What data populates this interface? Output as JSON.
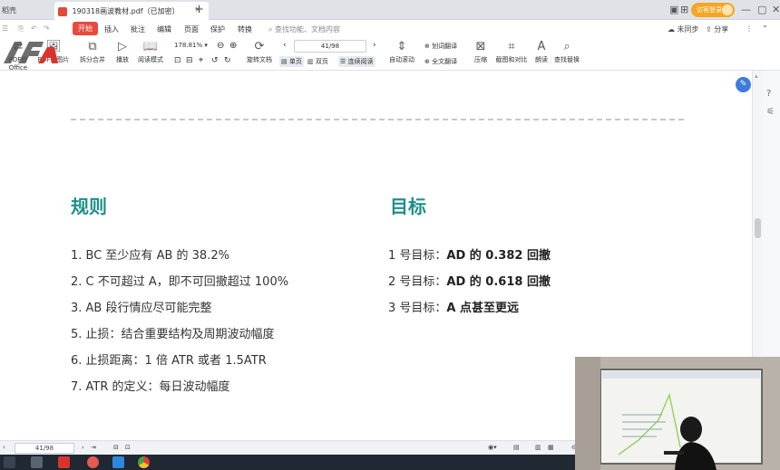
{
  "titlebar": {
    "home_label": "稻壳",
    "tab_title": "190318画波教材.pdf（已加密）",
    "tab_close": "×",
    "tab_add": "+",
    "login_label": "访客登录"
  },
  "menu": {
    "items": [
      "开始",
      "插入",
      "批注",
      "编辑",
      "页面",
      "保护",
      "转换"
    ],
    "search_placeholder": "查找功能、文档内容",
    "sync_label": "未同步",
    "share_label": "分享"
  },
  "toolbar": {
    "pdf_to_office": "PDF转Office",
    "pdf_to_image": "PDF转图片",
    "split_merge": "拆分合并",
    "play": "播放",
    "read_mode": "阅读模式",
    "zoom_value": "178.81%",
    "rotate_doc": "旋转文档",
    "page_input": "41/98",
    "single_page": "单页",
    "double_page": "双页",
    "continuous": "连续阅读",
    "auto_scroll": "自动滚动",
    "word_translate": "划词翻译",
    "full_translate": "全文翻译",
    "compress": "压缩",
    "screenshot_compare": "截图和对比",
    "read_aloud": "朗读",
    "find_replace": "查找替换"
  },
  "document": {
    "left_heading": "规则",
    "right_heading": "目标",
    "rules": [
      "1.  BC 至少应有 AB 的 38.2%",
      "2.  C 不可超过 A，即不可回撤超过 100%",
      "3.  AB 段行情应尽可能完整",
      "5.  止损：结合重要结构及周期波动幅度",
      "6.  止损距离：1 倍 ATR 或者 1.5ATR",
      "7.  ATR 的定义：每日波动幅度"
    ],
    "goals": [
      {
        "label": "1 号目标：",
        "value": "AD 的 0.382 回撤"
      },
      {
        "label": "2 号目标：",
        "value": "AD 的 0.618 回撤"
      },
      {
        "label": "3 号目标：",
        "value": "A 点甚至更远"
      }
    ]
  },
  "statusbar": {
    "page": "41/98"
  },
  "colors": {
    "heading": "#1f8f8a",
    "accent_red": "#e94a3f",
    "login_orange": "#f5a623"
  }
}
